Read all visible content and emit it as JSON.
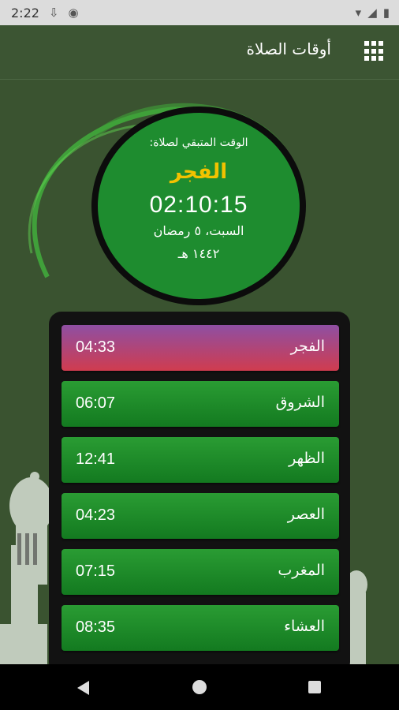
{
  "status_bar": {
    "time": "2:22",
    "icons": [
      "download-icon",
      "app-icon",
      "wifi-icon",
      "signal-icon",
      "battery-icon"
    ]
  },
  "app_bar": {
    "title": "أوقات الصلاة",
    "menu_icon": "grid-icon"
  },
  "countdown": {
    "label": "الوقت المتبقي لصلاة:",
    "next_prayer": "الفجر",
    "remaining": "02:10:15",
    "gregorian_date": "السبت، ٥ رمضان",
    "hijri_date": "١٤٤٢ هـ"
  },
  "prayers": [
    {
      "name": "الفجر",
      "time": "04:33",
      "active": true
    },
    {
      "name": "الشروق",
      "time": "06:07",
      "active": false
    },
    {
      "name": "الظهر",
      "time": "12:41",
      "active": false
    },
    {
      "name": "العصر",
      "time": "04:23",
      "active": false
    },
    {
      "name": "المغرب",
      "time": "07:15",
      "active": false
    },
    {
      "name": "العشاء",
      "time": "08:35",
      "active": false
    }
  ],
  "colors": {
    "background": "#3a5330",
    "row_green": "#1e8c2f",
    "active_row_start": "#8e4fa3",
    "active_row_end": "#d03c4f",
    "highlight_text": "#f2c200"
  }
}
